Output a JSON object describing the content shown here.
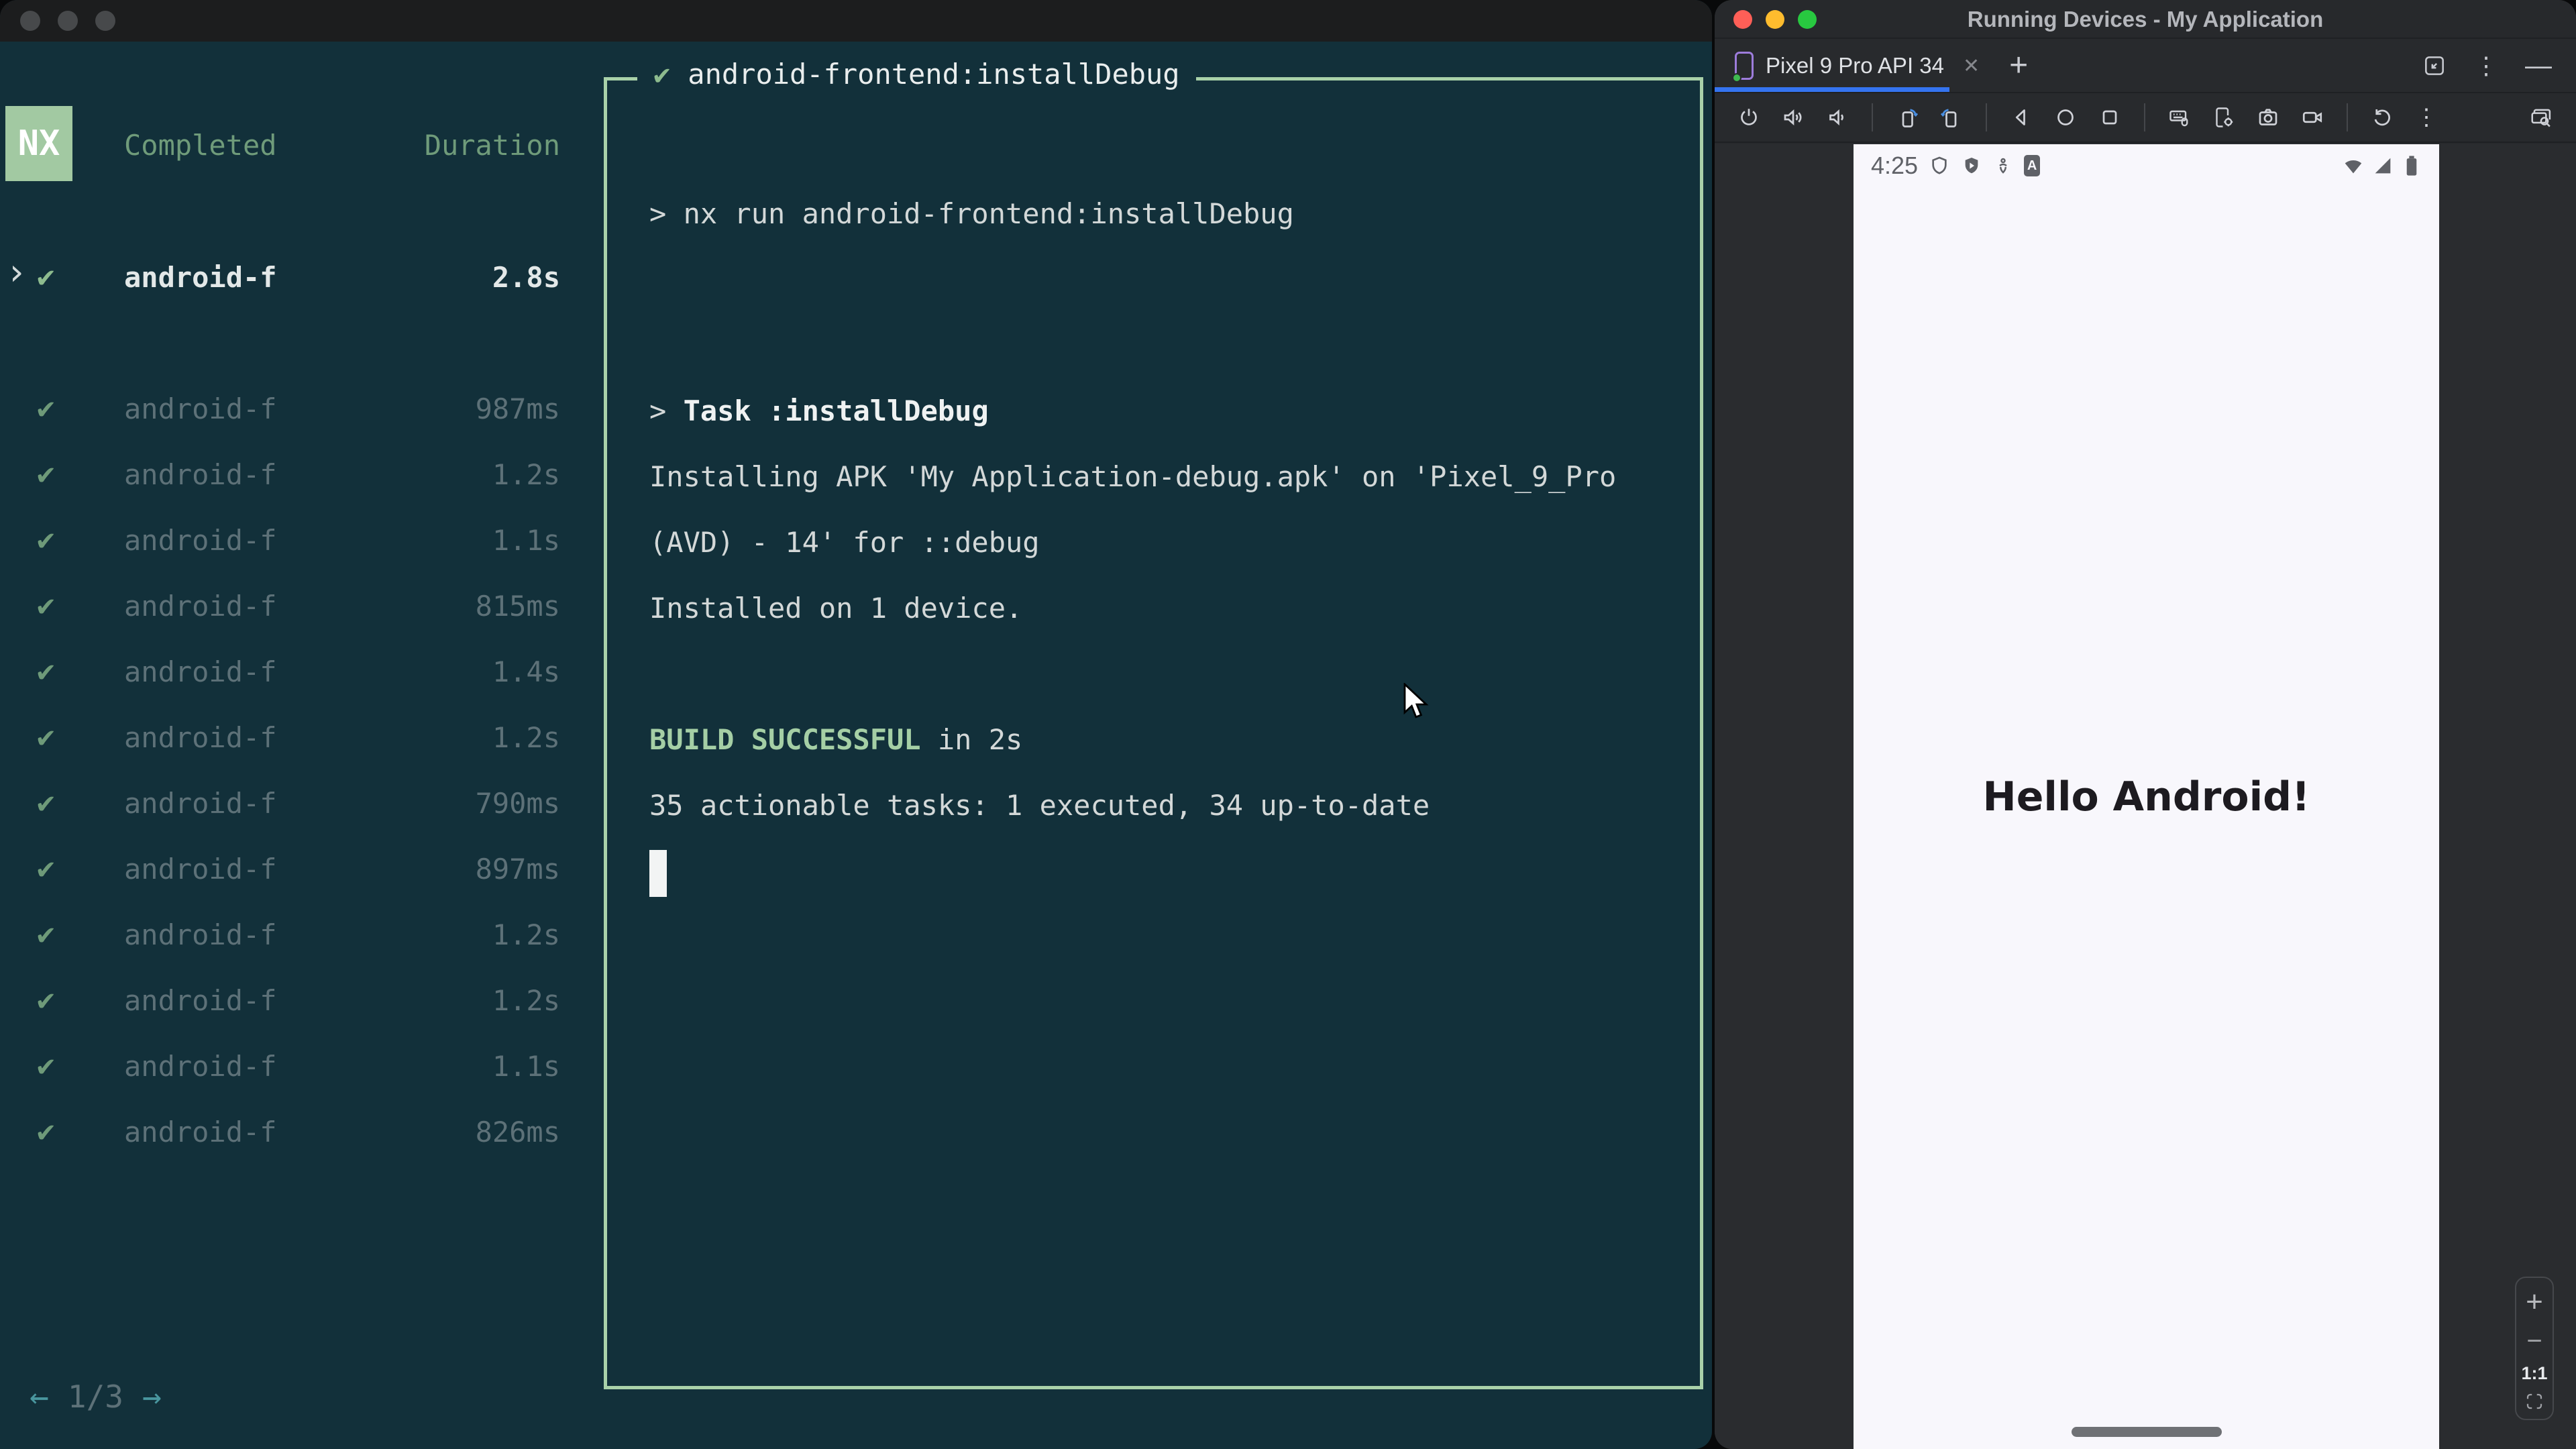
{
  "left_window": {
    "panel": {
      "logo": "NX",
      "columns": {
        "completed": "Completed",
        "duration": "Duration"
      },
      "active_task": {
        "chevron": "›",
        "check": "✔",
        "name": "android-f",
        "duration": "2.8s"
      },
      "check": "✔",
      "tasks": [
        {
          "name": "android-f",
          "duration": "987ms"
        },
        {
          "name": "android-f",
          "duration": "1.2s"
        },
        {
          "name": "android-f",
          "duration": "1.1s"
        },
        {
          "name": "android-f",
          "duration": "815ms"
        },
        {
          "name": "android-f",
          "duration": "1.4s"
        },
        {
          "name": "android-f",
          "duration": "1.2s"
        },
        {
          "name": "android-f",
          "duration": "790ms"
        },
        {
          "name": "android-f",
          "duration": "897ms"
        },
        {
          "name": "android-f",
          "duration": "1.2s"
        },
        {
          "name": "android-f",
          "duration": "1.2s"
        },
        {
          "name": "android-f",
          "duration": "1.1s"
        },
        {
          "name": "android-f",
          "duration": "826ms"
        }
      ],
      "pagination": {
        "prev": "←",
        "current": "1/3",
        "next": "→"
      }
    },
    "output": {
      "title_check": "✔",
      "title": "android-frontend:installDebug",
      "lines": {
        "command": "> nx run android-frontend:installDebug",
        "task_prefix": "> ",
        "task_bold": "Task :installDebug",
        "installing_1": "Installing APK 'My Application-debug.apk' on 'Pixel_9_Pro",
        "installing_2": "(AVD) - 14' for ::debug",
        "installed": "Installed on 1 device.",
        "build_successful": "BUILD SUCCESSFUL",
        "build_time": " in 2s",
        "tasks_summary": "35 actionable tasks: 1 executed, 34 up-to-date"
      }
    }
  },
  "right_window": {
    "title": "Running Devices - My Application",
    "tab": {
      "label": "Pixel 9 Pro API 34",
      "close": "✕",
      "new_tab": "+"
    },
    "window_controls": {
      "more": "⋮",
      "hide": "—"
    },
    "emulator": {
      "status_bar": {
        "time": "4:25"
      },
      "screen_text": "Hello Android!",
      "zoom_controls": {
        "zoom_in": "+",
        "zoom_out": "−",
        "actual_size": "1:1"
      }
    },
    "colors": {
      "accent_blue": "#3574f0",
      "nx_green": "#a2c9a2",
      "border_green": "#a9d1a9",
      "traffic_red": "#ff5f57",
      "traffic_yellow": "#febc2e",
      "traffic_green": "#28c840"
    }
  }
}
